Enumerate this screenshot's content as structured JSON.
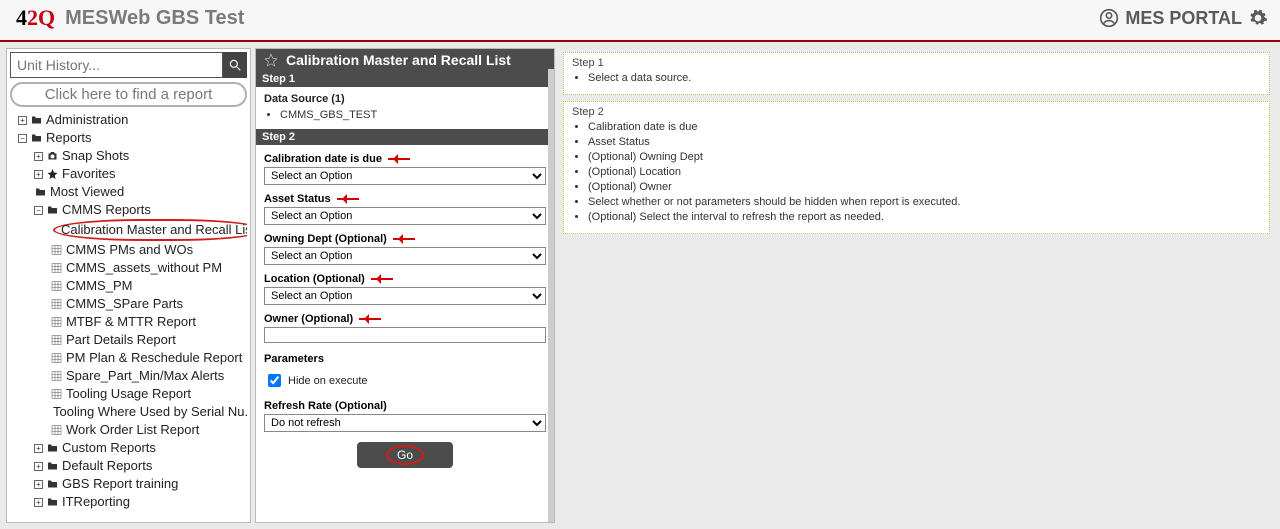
{
  "brand": {
    "appTitle": "MESWeb GBS Test",
    "portalLabel": "MES PORTAL"
  },
  "search": {
    "placeholder": "Unit History...",
    "findReport": "Click here to find a report"
  },
  "tree": {
    "administration": "Administration",
    "reports": "Reports",
    "snapShots": "Snap Shots",
    "favorites": "Favorites",
    "mostViewed": "Most Viewed",
    "cmmsReports": "CMMS Reports",
    "children": [
      "Calibration Master and Recall List",
      "CMMS PMs and WOs",
      "CMMS_assets_without PM",
      "CMMS_PM",
      "CMMS_SPare Parts",
      "MTBF & MTTR Report",
      "Part Details Report",
      "PM Plan & Reschedule Report",
      "Spare_Part_Min/Max Alerts",
      "Tooling Usage Report",
      "Tooling Where Used by Serial Nu...",
      "Work Order List Report"
    ],
    "customReports": "Custom Reports",
    "defaultReports": "Default Reports",
    "gbsTraining": "GBS Report training",
    "itReporting": "ITReporting"
  },
  "panel": {
    "title": "Calibration Master and Recall List",
    "step1": "Step 1",
    "step2": "Step 2",
    "dataSourceLabel": "Data Source (1)",
    "dataSourceValue": "CMMS_GBS_TEST",
    "fields": {
      "calDate": "Calibration date is due",
      "assetStatus": "Asset Status",
      "owningDept": "Owning Dept  (Optional)",
      "location": "Location  (Optional)",
      "owner": "Owner  (Optional)",
      "parameters": "Parameters",
      "hideOnExecute": "Hide on execute",
      "refreshRate": "Refresh Rate  (Optional)"
    },
    "optPlaceholder": "Select an Option",
    "refreshDefault": "Do not refresh",
    "goLabel": "Go"
  },
  "help": {
    "step1": {
      "title": "Step 1",
      "items": [
        "Select a data source."
      ]
    },
    "step2": {
      "title": "Step 2",
      "items": [
        "Calibration date is due",
        "Asset Status",
        "(Optional) Owning Dept",
        "(Optional) Location",
        "(Optional) Owner",
        "Select whether or not parameters should be hidden when report is executed.",
        "(Optional) Select the interval to refresh the report as needed."
      ]
    }
  }
}
